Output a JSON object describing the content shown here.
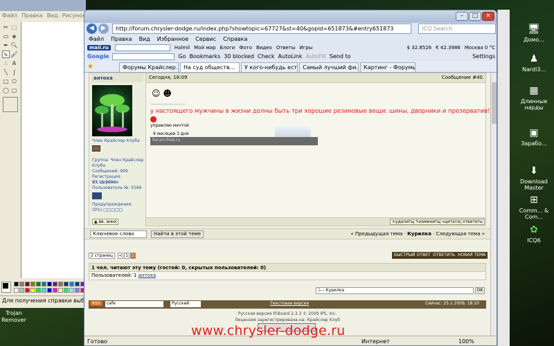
{
  "paint": {
    "menu": [
      "Файл",
      "Правка",
      "Вид",
      "Рисунок"
    ],
    "status_text": "Для получения справки выберите",
    "palette_colors": [
      "#000000",
      "#808080",
      "#800000",
      "#808000",
      "#008000",
      "#008080",
      "#000080",
      "#800080",
      "#808040",
      "#004040",
      "#0080ff",
      "#004080",
      "#8000ff",
      "#804000",
      "#ffffff",
      "#c0c0c0",
      "#ff0000",
      "#ffff00",
      "#00ff00",
      "#00ffff",
      "#0000ff",
      "#ff00ff",
      "#ffff80",
      "#00ff80",
      "#80ffff",
      "#8080ff",
      "#ff0080",
      "#ff8040"
    ]
  },
  "desktop": {
    "trojan_label": "Trojan Remover",
    "icons": [
      {
        "icon": "computer-icon",
        "label": "Домо..."
      },
      {
        "icon": "nardi-icon",
        "label": "Nardi3..."
      },
      {
        "icon": "folder-icon",
        "label": "Длинные нарды"
      },
      {
        "icon": "money-icon",
        "label": "Зарабо..."
      },
      {
        "icon": "download-icon",
        "label": "Download Master"
      },
      {
        "icon": "network-icon",
        "label": "Comm... & Com..."
      },
      {
        "icon": "icq-icon",
        "label": "ICQ6"
      }
    ]
  },
  "browser": {
    "url": "http://forum.chrysler-dodge.ru/index.php?showtopic=67727&st=40&gopid=651873&#entry651873",
    "search_placeholder": "ICQ Search",
    "menu": [
      "Файл",
      "Правка",
      "Вид",
      "Избранное",
      "Сервис",
      "Справка"
    ],
    "toolbar1": {
      "logo": "mail.ru",
      "halmil": "Halmil",
      "items": [
        "Мой мир",
        "Блоги",
        "Фото",
        "Видео",
        "Ответы",
        "Игры"
      ],
      "stock1": "$ 32.8526",
      "stock2": "€ 42.3986",
      "weather": "Москва 0 °C"
    },
    "toolbar2": {
      "google": "Google",
      "go": "Go",
      "bookmarks": "Bookmarks",
      "blocked": "30 blocked",
      "check": "Check",
      "autolink": "AutoLink",
      "autofill": "AutoFill",
      "sendto": "Send to",
      "settings": "Settings"
    },
    "tabs": [
      "Форумы Крайслер...",
      "На суд обществ...",
      "У кого-нибудь ест...",
      "Самый лучший фи...",
      "Картинг - Форумы..."
    ],
    "status_left": "Готово",
    "status_internet": "Интернет",
    "status_zoom": "100%"
  },
  "forum": {
    "author": "антоха",
    "post_date": "Сегодня, 18:09",
    "post_number": "Сообщение #40",
    "author_info": {
      "title": "Член Крайслер Клуба",
      "group": "Группа: Член Крайслер Клуба",
      "posts": "Сообщений: 999",
      "registered": "Регистрация: 13.11.2006",
      "from": "Из: деревни",
      "user_no": "Пользователь №: 5566",
      "warnings": "Предупреждения:",
      "warn_level": "(0%) □□□□□"
    },
    "dashes": "--------------------",
    "quote": "у настоящего мужчины в жизни долны быть три хорошие резиновые вещи: шины, дворники и презерватив!",
    "sig_line1": "управляю мечтой",
    "sig_line2": "9 месяцев 3 дня",
    "sig_site": "forum-fnet.ru",
    "to_top": "▲ вв. аннх",
    "post_buttons": [
      "×удалить",
      "✎изменить",
      "«цитата",
      "ответить"
    ],
    "search_input": "Ключевое слово",
    "search_button": "Найти в этой теме",
    "nav_prev": "« Предыдущая тема",
    "nav_forum": "Курилка",
    "nav_next": "Следующая тема »",
    "pages_select": "2 страниц",
    "pages": [
      "<",
      "1",
      "2"
    ],
    "btn_fast_reply": "БЫСТРЫЙ ОТВЕТ",
    "btn_reply": "ОТВЕТИТЬ",
    "btn_new_topic": "НОВАЯ ТЕМА",
    "readers": "1 чел. читают эту тему (гостей: 0, скрытых пользователей: 0)",
    "users_label": "Пользователей: 1",
    "users_name": "антоха",
    "jump_select": "|--- Курилка",
    "jump_ok": "OK",
    "rss": "RSS",
    "skin": "cafe",
    "lang": "Русский",
    "text_version": "Текстовая версия",
    "now": "Сейчас: 25.1.2009, 18:10",
    "copyright1": "Русская версия IP.Board 2.3.3 © 2009 IPS, Inc.",
    "copyright2": "Лицензия зарегистрирована на: Крайслер Клуб"
  },
  "watermark": "www.chrysler-dodge.ru"
}
